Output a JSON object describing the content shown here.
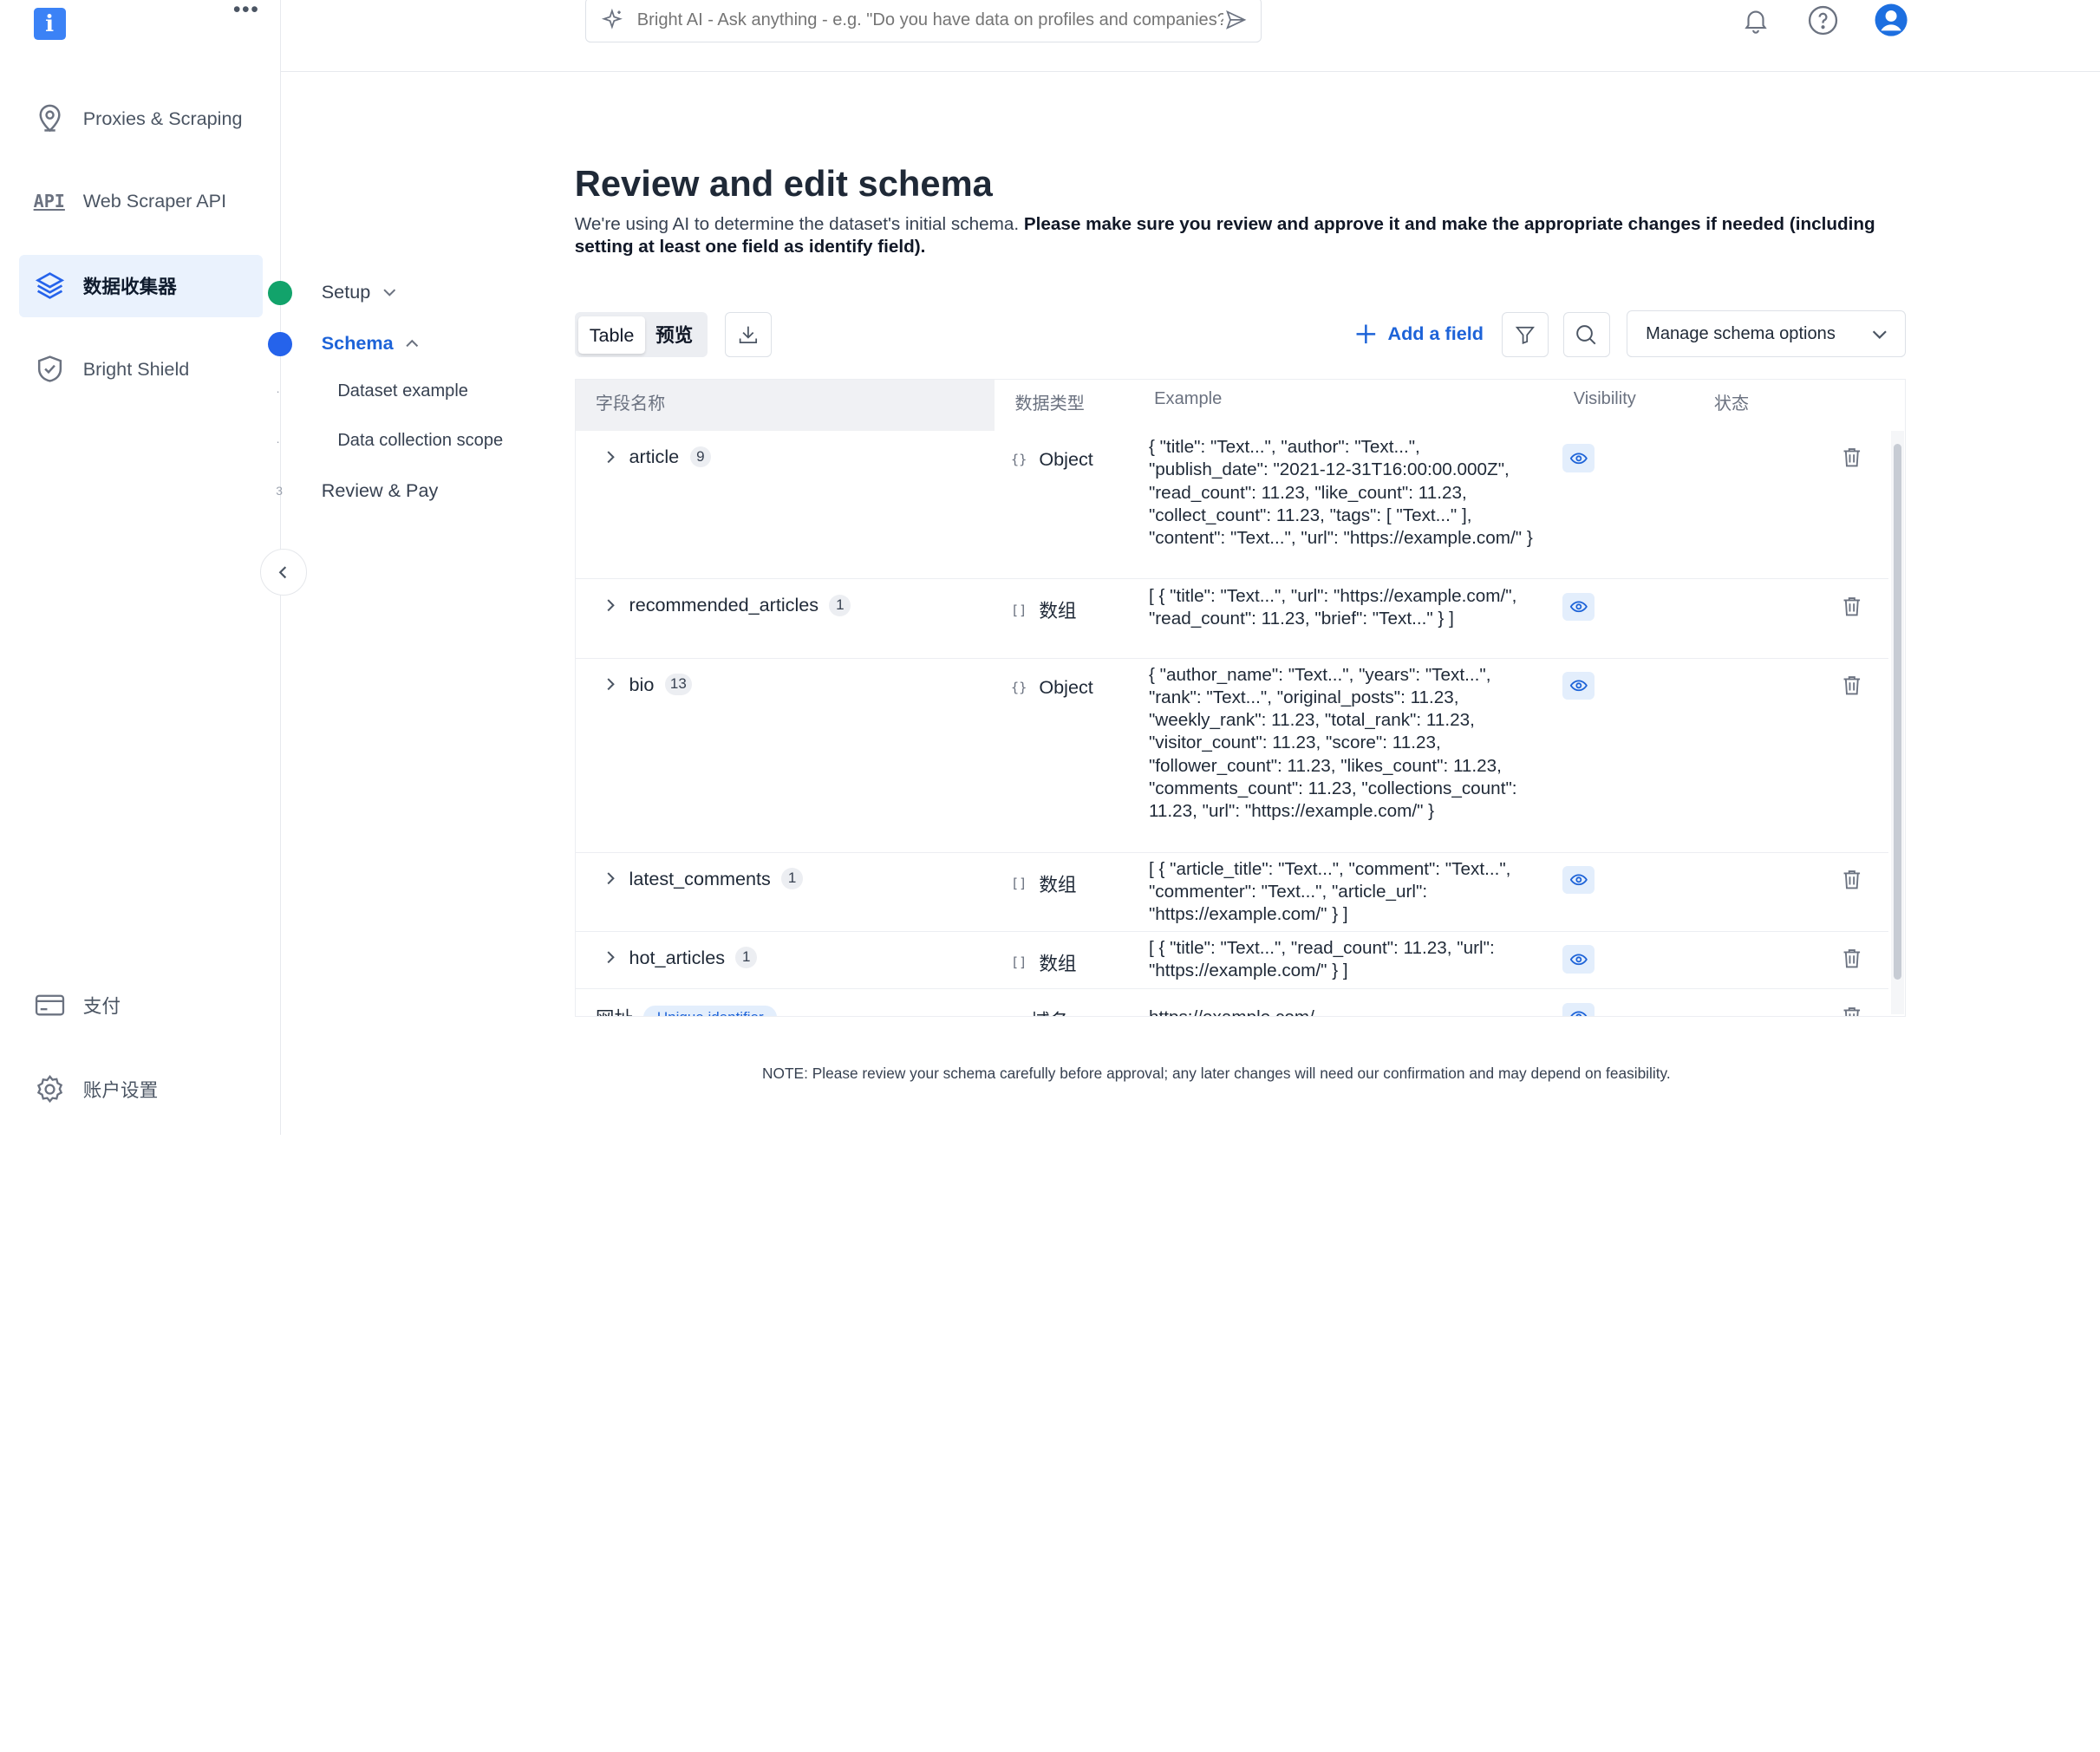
{
  "sidebar": {
    "logo_letter": "i",
    "more": "•••",
    "items": [
      {
        "label": "Proxies & Scraping",
        "icon": "location-pin-icon"
      },
      {
        "label": "Web Scraper API",
        "icon": "api-icon",
        "glyph": "API"
      },
      {
        "label": "数据收集器",
        "icon": "layers-icon",
        "active": true
      },
      {
        "label": "Bright Shield",
        "icon": "shield-icon"
      }
    ],
    "bottom": [
      {
        "label": "支付",
        "icon": "credit-card-icon"
      },
      {
        "label": "账户设置",
        "icon": "gear-icon"
      }
    ]
  },
  "steps": {
    "items": [
      {
        "label": "Setup",
        "state": "done"
      },
      {
        "label": "Schema",
        "state": "current"
      },
      {
        "label": "Review & Pay",
        "state": "todo"
      }
    ],
    "substeps": [
      "Dataset example",
      "Data collection scope"
    ],
    "step3_number": "3"
  },
  "topbar": {
    "search_placeholder": "Bright AI - Ask anything - e.g. \"Do you have data on profiles and companies?\""
  },
  "main": {
    "title": "Review and edit schema",
    "subtitle_plain": "We're using AI to determine the dataset's initial schema. ",
    "subtitle_bold": "Please make sure you review and approve it and make the appropriate changes if needed (including setting at least one field as identify field).",
    "tabs": [
      {
        "label": "Table",
        "selected": true
      },
      {
        "label": "预览",
        "selected": false
      }
    ],
    "add_field": "Add a field",
    "manage_options": "Manage schema options",
    "note": "NOTE: Please review your schema carefully before approval; any later changes will need our confirmation and may depend on feasibility."
  },
  "table": {
    "headers": {
      "name": "字段名称",
      "type": "数据类型",
      "example": "Example",
      "visibility": "Visibility",
      "status": "状态"
    },
    "rows": [
      {
        "name": "article",
        "count": "9",
        "type": "Object",
        "type_glyph": "{}",
        "example": "{ \"title\": \"Text...\", \"author\": \"Text...\", \"publish_date\": \"2021-12-31T16:00:00.000Z\", \"read_count\": 11.23, \"like_count\": 11.23, \"collect_count\": 11.23, \"tags\": [ \"Text...\" ], \"content\": \"Text...\", \"url\": \"https://example.com/\" }"
      },
      {
        "name": "recommended_articles",
        "count": "1",
        "type": "数组",
        "type_glyph": "[]",
        "example": "[ { \"title\": \"Text...\", \"url\": \"https://example.com/\", \"read_count\": 11.23, \"brief\": \"Text...\" } ]"
      },
      {
        "name": "bio",
        "count": "13",
        "type": "Object",
        "type_glyph": "{}",
        "example": "{ \"author_name\": \"Text...\", \"years\": \"Text...\", \"rank\": \"Text...\", \"original_posts\": 11.23, \"weekly_rank\": 11.23, \"total_rank\": 11.23, \"visitor_count\": 11.23, \"score\": 11.23, \"follower_count\": 11.23, \"likes_count\": 11.23, \"comments_count\": 11.23, \"collections_count\": 11.23, \"url\": \"https://example.com/\" }"
      },
      {
        "name": "latest_comments",
        "count": "1",
        "type": "数组",
        "type_glyph": "[]",
        "example": "[ { \"article_title\": \"Text...\", \"comment\": \"Text...\", \"commenter\": \"Text...\", \"article_url\": \"https://example.com/\" } ]"
      },
      {
        "name": "hot_articles",
        "count": "1",
        "type": "数组",
        "type_glyph": "[]",
        "example": "[ { \"title\": \"Text...\", \"read_count\": 11.23, \"url\": \"https://example.com/\" } ]"
      },
      {
        "name": "网址",
        "badge": "Unique identifier",
        "type": "域名",
        "type_glyph": "▭",
        "example": "https://example.com/"
      }
    ]
  }
}
